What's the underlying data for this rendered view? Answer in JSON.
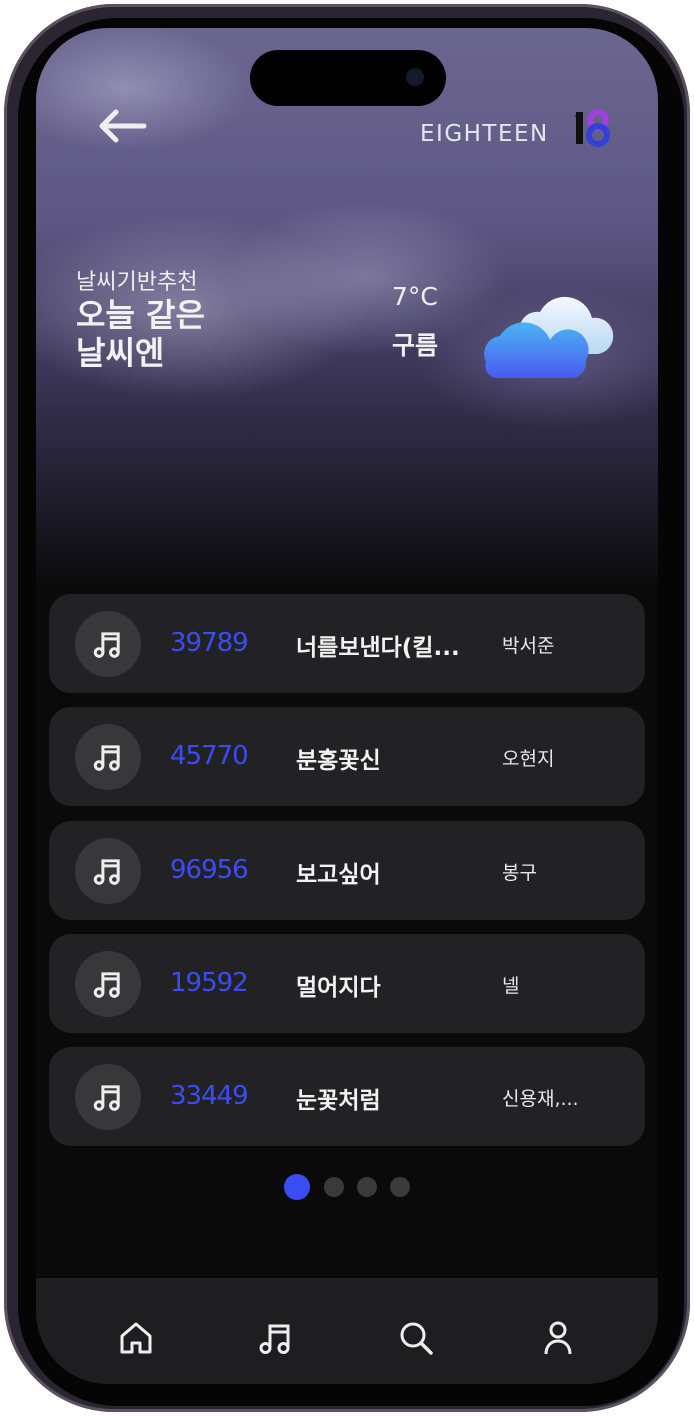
{
  "header": {
    "back_icon": "arrow-left-icon",
    "brand": "EIGHTEEN",
    "logo_text": "18"
  },
  "weather": {
    "subtitle": "날씨기반추천",
    "title_line1": "오늘 같은",
    "title_line2": "날씨엔",
    "temperature": "7°C",
    "condition": "구름",
    "icon": "cloud-icon"
  },
  "songs": [
    {
      "number": "39789",
      "title": "너를보낸다(킬...",
      "artist": "박서준"
    },
    {
      "number": "45770",
      "title": "분홍꽃신",
      "artist": "오현지"
    },
    {
      "number": "96956",
      "title": "보고싶어",
      "artist": "봉구"
    },
    {
      "number": "19592",
      "title": "멀어지다",
      "artist": "넬"
    },
    {
      "number": "33449",
      "title": "눈꽃처럼",
      "artist": "신용재,..."
    }
  ],
  "pagination": {
    "pages": 4,
    "current": 1
  },
  "nav": {
    "items": [
      "home-icon",
      "music-icon",
      "search-icon",
      "user-icon"
    ]
  },
  "colors": {
    "accent": "#3a4df5",
    "card": "#222224",
    "background": "#0a0a0b"
  }
}
